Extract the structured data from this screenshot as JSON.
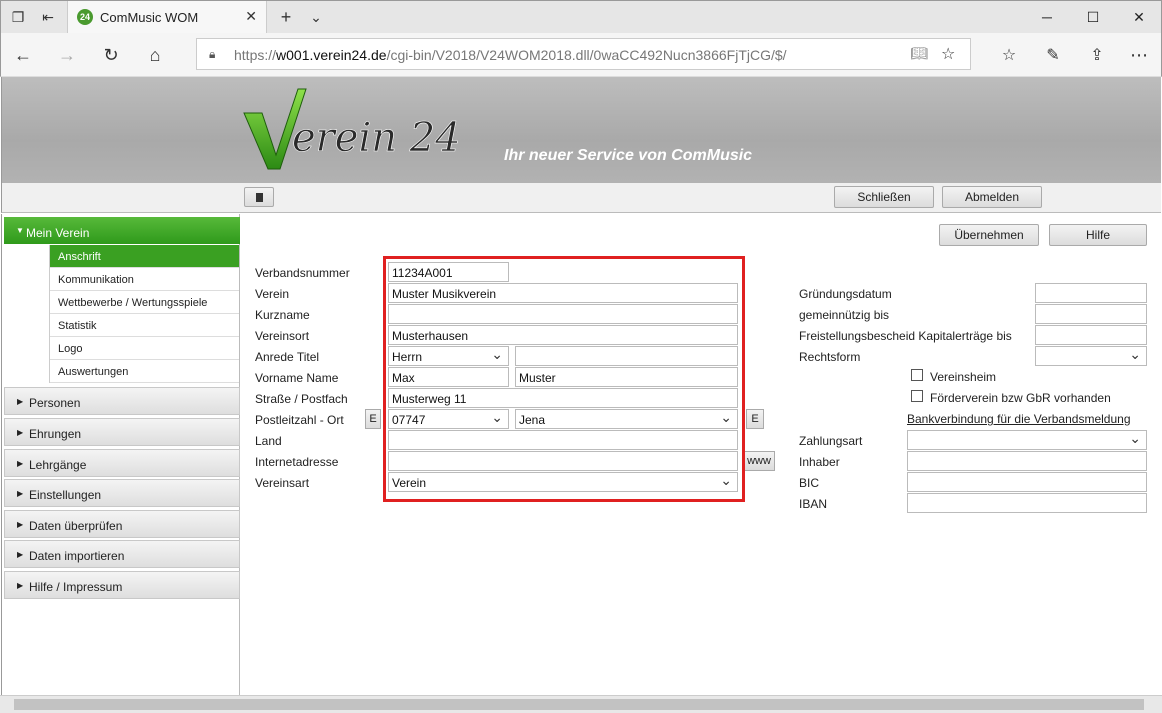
{
  "browser": {
    "tab_title": "ComMusic WOM",
    "tab_favicon_text": "24",
    "url_host": "w001.verein24.de",
    "url_path": "/cgi-bin/V2018/V24WOM2018.dll/0waCC492Nucn3866FjTjCG/$/",
    "url_scheme": "https://"
  },
  "header": {
    "logo_text": "Verein 24",
    "tagline": "Ihr neuer Service von ComMusic"
  },
  "toolbar": {
    "close_label": "Schließen",
    "logout_label": "Abmelden"
  },
  "actions": {
    "apply_label": "Übernehmen",
    "help_label": "Hilfe"
  },
  "sidebar": {
    "active_group": "Mein Verein",
    "subitems": [
      "Anschrift",
      "Kommunikation",
      "Wettbewerbe / Wertungsspiele",
      "Statistik",
      "Logo",
      "Auswertungen"
    ],
    "groups": [
      "Personen",
      "Ehrungen",
      "Lehrgänge",
      "Einstellungen",
      "Daten überprüfen",
      "Daten importieren",
      "Hilfe / Impressum"
    ]
  },
  "form": {
    "labels": {
      "verbandsnummer": "Verbandsnummer",
      "verein": "Verein",
      "kurzname": "Kurzname",
      "vereinsort": "Vereinsort",
      "anrede": "Anrede Titel",
      "name": "Vorname Name",
      "strasse": "Straße / Postfach",
      "plz": "Postleitzahl - Ort",
      "land": "Land",
      "internet": "Internetadresse",
      "vereinsart": "Vereinsart"
    },
    "values": {
      "verbandsnummer": "11234A001",
      "verein": "Muster Musikverein",
      "kurzname": "",
      "vereinsort": "Musterhausen",
      "anrede": "Herrn",
      "titel": "",
      "vorname": "Max",
      "nachname": "Muster",
      "strasse": "Musterweg 11",
      "plz": "07747",
      "ort": "Jena",
      "land": "",
      "internet": "",
      "vereinsart": "Verein"
    },
    "small_buttons": {
      "plz_left": "E",
      "plz_right": "E",
      "www": "www"
    }
  },
  "right": {
    "labels": {
      "gruendung": "Gründungsdatum",
      "gemeinnuetzig": "gemeinnützig bis",
      "freistellung": "Freistellungsbescheid Kapitalerträge bis",
      "rechtsform": "Rechtsform",
      "vereinsheim": "Vereinsheim",
      "foerderverein": "Förderverein bzw GbR vorhanden",
      "bank_link": "Bankverbindung für die Verbandsmeldung",
      "zahlungsart": "Zahlungsart",
      "inhaber": "Inhaber",
      "bic": "BIC",
      "iban": "IBAN"
    }
  },
  "colors": {
    "accent_green": "#3aa022",
    "highlight_red": "#e02020"
  }
}
